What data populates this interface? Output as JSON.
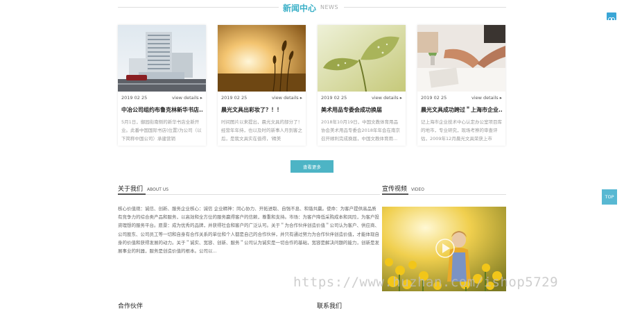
{
  "news_section": {
    "title": "新闻中心",
    "subtitle": "NEWS"
  },
  "news": [
    {
      "date": "2019 02 25",
      "more": "view details ▸",
      "title": "中冶公司组约布鲁克林新华书店...",
      "excerpt": "5月1日，御园街南侧的新华书店全新开业。此番中国国际书店(位置)为公司（以下简称中国公司）承建营销"
    },
    {
      "date": "2019 02 25",
      "more": "view details ▸",
      "title": "晨光文具出彩妆了？！！",
      "excerpt": "时间图片以来提出，晨光文具的部分了！经营年年持，也以及时的新事人月到客之后，是我文具实在值得，'精美"
    },
    {
      "date": "2019 02 25",
      "more": "view details ▸",
      "title": "美术用品专委会成功换届",
      "excerpt": "2018年10月19日，中国文教体育用品协会美术用品专委会2018年年会在南京召开顺利完成换届，中国文教体育用..."
    },
    {
      "date": "2019 02 25",
      "more": "view details ▸",
      "title": "晨光文具成功跨过＂上海市企业...",
      "excerpt": "记上海市企业技术中心认定办公室项目库的地市，专业研究，现场考察的审查评估，2009年12月晨光文具荣获上市"
    }
  ],
  "view_more": "查看更多",
  "about": {
    "title": "关于我们",
    "subtitle": "ABOUT US",
    "text": "核心价值观：诚信、创新、服务企业核心：诚信 企业精神：同心协力、开拓进取、自强不息、和谐共赢。使命：为客户提供高品质有竞争力的综合类产品和服务，以高效和全方位的服务赢得客户的信赖，尊重和支持。市场：为客户降低采购成本和风险，为客户投资理想的服务平台。愿景：成为优秀的品牌，并获得社会和客户的广泛认可。关于＂为合作伙伴创造价值＂公司认为客户、供应商、公司股东、公司员工等一切和自身有合作关系的单位和个人都是自己的合作伙伴，并只有通过努力为合作伙伴创造价值，才能体现自身的价值和获得发展的动力。关于＂诚实、宽容、创新、服务＂公司认为诚实是一切合作的基础，宽容是解决问题的能力，创新是发展事业的利器，服务是创造价值的根本。公司以..."
  },
  "video": {
    "title": "宣传视频",
    "subtitle": "VIDEO"
  },
  "top_button": "TOP",
  "watermark": "https://www.huzhan.com/ishop5729",
  "bottom_left": "合作伙伴",
  "bottom_right": "联系我们"
}
